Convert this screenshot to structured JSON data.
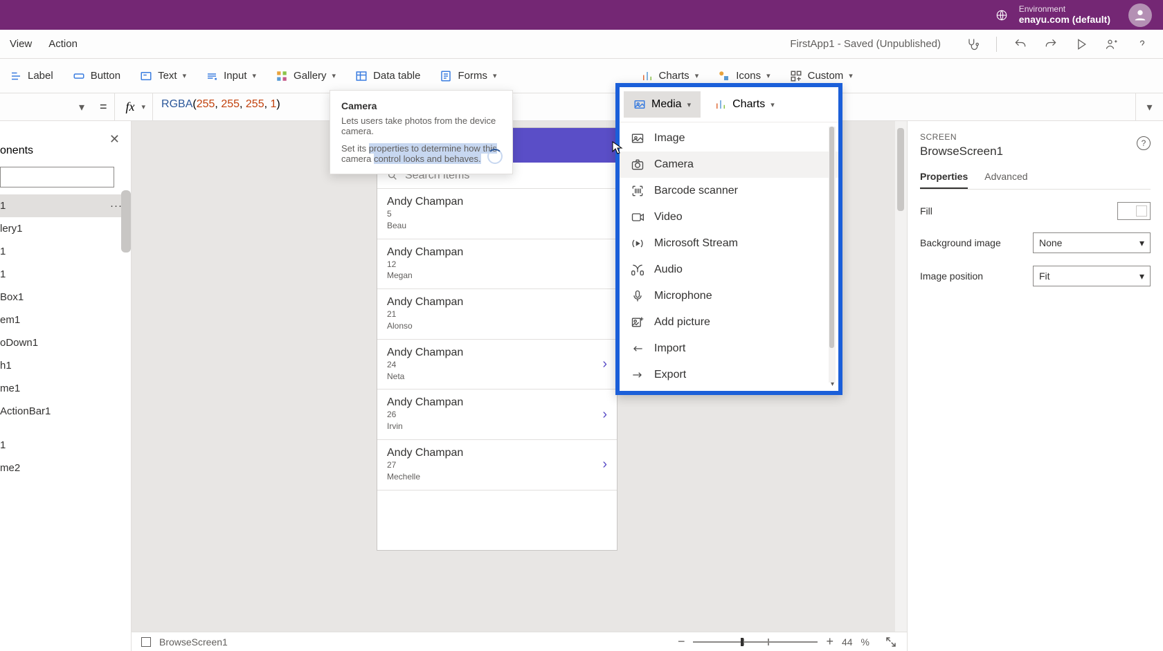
{
  "header": {
    "env_label": "Environment",
    "env_name": "enayu.com (default)"
  },
  "menubar": {
    "view": "View",
    "action": "Action",
    "app_status": "FirstApp1 - Saved (Unpublished)"
  },
  "ribbon": {
    "label": "Label",
    "button": "Button",
    "text": "Text",
    "input": "Input",
    "gallery": "Gallery",
    "data_table": "Data table",
    "forms": "Forms",
    "media": "Media",
    "charts": "Charts",
    "icons": "Icons",
    "custom": "Custom"
  },
  "formula": {
    "fn": "RGBA",
    "open": "(",
    "n1": "255",
    "c": ", ",
    "n2": "255",
    "n3": "255",
    "n4": "1",
    "close": ")"
  },
  "tree": {
    "tab": "onents",
    "items": [
      "1",
      "lery1",
      "1",
      "1",
      "Box1",
      "em1",
      "oDown1",
      "h1",
      "me1",
      "ActionBar1",
      "",
      "1",
      "me2"
    ]
  },
  "tooltip": {
    "title": "Camera",
    "line1": "Lets users take photos from the device camera.",
    "line2a": "Set its ",
    "line2b": "properties to determine how this",
    "line3": " camera ",
    "line3b": "control looks and behaves."
  },
  "phone": {
    "search_placeholder": "Search items",
    "rows": [
      {
        "name": "Andy Champan",
        "num": "5",
        "sub": "Beau"
      },
      {
        "name": "Andy Champan",
        "num": "12",
        "sub": "Megan"
      },
      {
        "name": "Andy Champan",
        "num": "21",
        "sub": "Alonso"
      },
      {
        "name": "Andy Champan",
        "num": "24",
        "sub": "Neta"
      },
      {
        "name": "Andy Champan",
        "num": "26",
        "sub": "Irvin"
      },
      {
        "name": "Andy Champan",
        "num": "27",
        "sub": "Mechelle"
      }
    ]
  },
  "media_menu": {
    "charts": "Charts",
    "items": [
      "Image",
      "Camera",
      "Barcode scanner",
      "Video",
      "Microsoft Stream",
      "Audio",
      "Microphone",
      "Add picture",
      "Import",
      "Export"
    ]
  },
  "props": {
    "label": "SCREEN",
    "name": "BrowseScreen1",
    "tab_properties": "Properties",
    "tab_advanced": "Advanced",
    "fill": "Fill",
    "bg_image": "Background image",
    "bg_image_val": "None",
    "img_pos": "Image position",
    "img_pos_val": "Fit"
  },
  "status": {
    "screen": "BrowseScreen1",
    "zoom": "44",
    "pct": "%"
  }
}
